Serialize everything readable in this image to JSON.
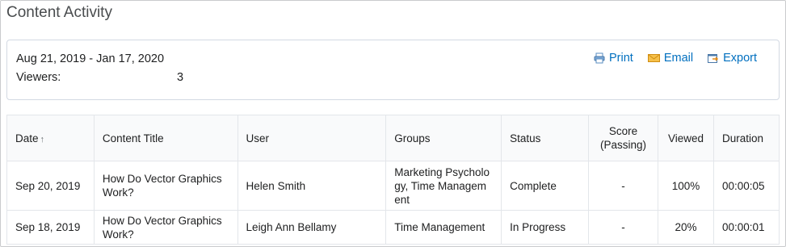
{
  "page": {
    "title": "Content Activity"
  },
  "summary": {
    "date_range": "Aug 21, 2019 - Jan 17, 2020",
    "viewers_label": "Viewers:",
    "viewers_value": "3",
    "actions": {
      "print": "Print",
      "email": "Email",
      "export": "Export"
    }
  },
  "colors": {
    "link": "#006fbf",
    "complete": "#46a661",
    "header_bg": "#f9fafb"
  },
  "table": {
    "headers": {
      "date": "Date",
      "date_sort": "↑",
      "content_title": "Content Title",
      "user": "User",
      "groups": "Groups",
      "status": "Status",
      "score_line1": "Score",
      "score_line2": "(Passing)",
      "viewed": "Viewed",
      "duration": "Duration"
    },
    "rows": [
      {
        "date": "Sep 20, 2019",
        "content_title_l1": "How Do Vector Graphics",
        "content_title_l2": "Work?",
        "user": "Helen Smith",
        "groups_l1": "Marketing Psycholo",
        "groups_l2": "gy, Time Managem",
        "groups_l3": "ent",
        "status": "Complete",
        "score": "-",
        "viewed": "100%",
        "duration": "00:00:05"
      },
      {
        "date": "Sep 18, 2019",
        "content_title_l1": "How Do Vector Graphics",
        "content_title_l2": "Work?",
        "user": "Leigh Ann Bellamy",
        "groups_l1": "Time Management",
        "status": "In Progress",
        "score": "-",
        "viewed": "20%",
        "duration": "00:00:01"
      }
    ]
  }
}
